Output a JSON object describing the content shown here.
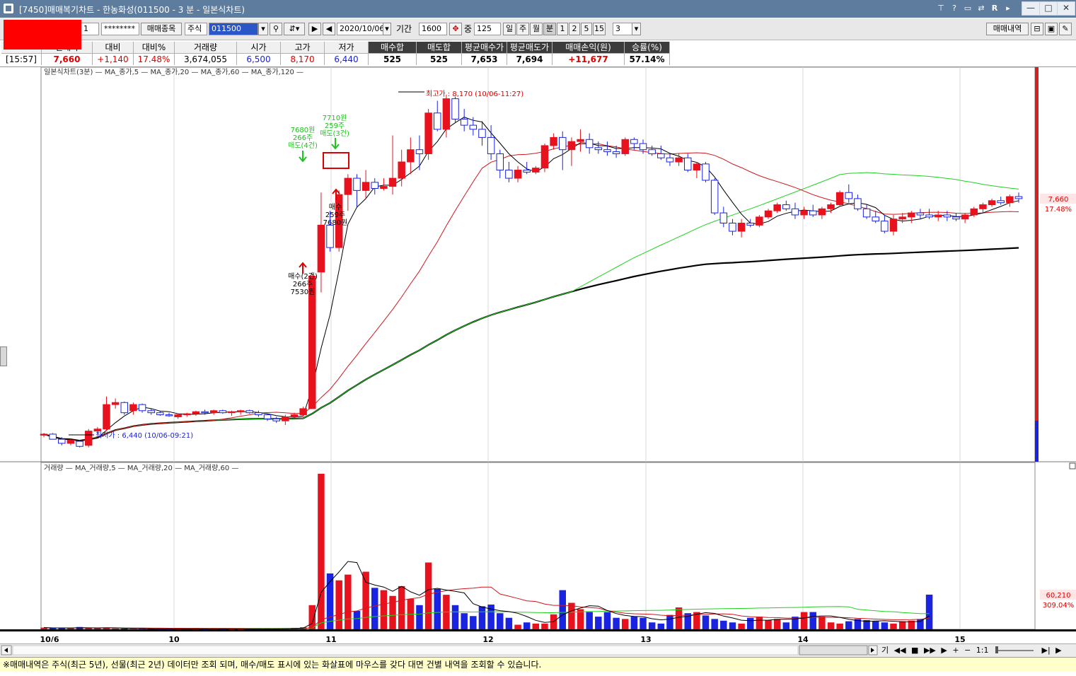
{
  "window": {
    "title": "[7450]매매복기차트 - 한농화성(011500 - 3 분 - 일본식차트)",
    "title_icons": [
      "pin-icon",
      "help-icon",
      "window-icon",
      "link-icon",
      "R",
      "menu-icon"
    ],
    "buttons": {
      "minimize": "—",
      "maximize": "□",
      "close": "✕"
    }
  },
  "toolbar": {
    "account_suffix": "1",
    "password": "********",
    "trade_stock_btn": "매매종목",
    "market_type": "주식",
    "code": "011500",
    "date": "2020/10/06",
    "period_label": "기간",
    "period_value": "1600",
    "middle_label": "중",
    "middle_value": "125",
    "periods": [
      "일",
      "주",
      "월",
      "분",
      "1",
      "2",
      "5",
      "15"
    ],
    "minute_select": "3",
    "history_btn": "매매내역"
  },
  "info": {
    "headers": [
      "",
      "현재가",
      "대비",
      "대비%",
      "거래량",
      "시가",
      "고가",
      "저가",
      "매수합",
      "매도합",
      "평균매수가",
      "평균매도가",
      "매매손익(원)",
      "승률(%)"
    ],
    "values": [
      "[15:57]",
      "7,660",
      "+1,140",
      "17.48%",
      "3,674,055",
      "6,500",
      "8,170",
      "6,440",
      "525",
      "525",
      "7,653",
      "7,694",
      "+11,677",
      "57.14%"
    ]
  },
  "chart_data": [
    {
      "type": "candlestick",
      "legend": "일본식차트(3분) — MA_종가,5 — MA_종가,20 — MA_종가,60 — MA_종가,120 —",
      "legend_items": [
        {
          "name": "일본식차트(3분)",
          "color": "#d0181c"
        },
        {
          "name": "MA_종가,5",
          "color": "#000000"
        },
        {
          "name": "MA_종가,20",
          "color": "#d0181c"
        },
        {
          "name": "MA_종가,60",
          "color": "#1ed21e"
        },
        {
          "name": "MA_종가,120",
          "color": "#000000"
        }
      ],
      "x_tick_labels": [
        "10/6",
        "10",
        "11",
        "12",
        "13",
        "14",
        "15"
      ],
      "y_range": [
        6380,
        8270
      ],
      "current_price_label": "7,660",
      "current_pct_label": "17.48%",
      "annotations": {
        "high": "최고가 : 8,170 (10/06-11:27)",
        "low": "최저가 : 6,440 (10/06-09:21)",
        "sell1": [
          "7680원",
          "266주",
          "매도(4건)"
        ],
        "sell2": [
          "7710원",
          "259주",
          "매도(3건)"
        ],
        "buy1": [
          "매수(2건)",
          "266주",
          "7530원"
        ],
        "buy2": [
          "매수",
          "259주",
          "7680원"
        ]
      },
      "ohlc": [
        [
          6500,
          6510,
          6490,
          6505
        ],
        [
          6505,
          6510,
          6480,
          6480
        ],
        [
          6480,
          6490,
          6450,
          6460
        ],
        [
          6460,
          6480,
          6450,
          6475
        ],
        [
          6470,
          6475,
          6440,
          6445
        ],
        [
          6450,
          6530,
          6440,
          6520
        ],
        [
          6520,
          6540,
          6500,
          6530
        ],
        [
          6530,
          6690,
          6520,
          6650
        ],
        [
          6650,
          6680,
          6630,
          6660
        ],
        [
          6660,
          6665,
          6600,
          6610
        ],
        [
          6620,
          6660,
          6600,
          6650
        ],
        [
          6650,
          6655,
          6610,
          6620
        ],
        [
          6620,
          6630,
          6600,
          6610
        ],
        [
          6610,
          6620,
          6595,
          6600
        ],
        [
          6600,
          6610,
          6590,
          6595
        ],
        [
          6590,
          6605,
          6580,
          6600
        ],
        [
          6600,
          6610,
          6590,
          6605
        ],
        [
          6605,
          6620,
          6595,
          6615
        ],
        [
          6615,
          6625,
          6600,
          6610
        ],
        [
          6610,
          6625,
          6600,
          6620
        ],
        [
          6620,
          6625,
          6605,
          6610
        ],
        [
          6610,
          6620,
          6595,
          6615
        ],
        [
          6615,
          6625,
          6600,
          6620
        ],
        [
          6620,
          6625,
          6605,
          6610
        ],
        [
          6610,
          6620,
          6590,
          6600
        ],
        [
          6600,
          6605,
          6570,
          6580
        ],
        [
          6580,
          6590,
          6560,
          6570
        ],
        [
          6570,
          6600,
          6550,
          6590
        ],
        [
          6590,
          6610,
          6580,
          6600
        ],
        [
          6600,
          6640,
          6590,
          6630
        ],
        [
          6630,
          7300,
          6630,
          7280
        ],
        [
          7300,
          7690,
          7200,
          7530
        ],
        [
          7530,
          7600,
          7400,
          7420
        ],
        [
          7420,
          7700,
          7400,
          7680
        ],
        [
          7680,
          7780,
          7600,
          7760
        ],
        [
          7760,
          7780,
          7620,
          7700
        ],
        [
          7700,
          7800,
          7660,
          7740
        ],
        [
          7740,
          7760,
          7680,
          7710
        ],
        [
          7710,
          7760,
          7700,
          7720
        ],
        [
          7720,
          7970,
          7680,
          7760
        ],
        [
          7760,
          7900,
          7720,
          7840
        ],
        [
          7840,
          7960,
          7780,
          7900
        ],
        [
          7900,
          7970,
          7800,
          7880
        ],
        [
          7880,
          8100,
          7850,
          8080
        ],
        [
          8080,
          8140,
          7990,
          8000
        ],
        [
          8000,
          8170,
          7960,
          8150
        ],
        [
          8150,
          8160,
          8030,
          8050
        ],
        [
          8050,
          8100,
          7990,
          8020
        ],
        [
          8020,
          8060,
          7970,
          8000
        ],
        [
          8000,
          8040,
          7920,
          7960
        ],
        [
          7960,
          8020,
          7850,
          7880
        ],
        [
          7880,
          7900,
          7760,
          7800
        ],
        [
          7800,
          7840,
          7740,
          7760
        ],
        [
          7760,
          7820,
          7740,
          7800
        ],
        [
          7800,
          7840,
          7780,
          7790
        ],
        [
          7790,
          7820,
          7780,
          7810
        ],
        [
          7810,
          7930,
          7790,
          7920
        ],
        [
          7920,
          7980,
          7900,
          7960
        ],
        [
          7960,
          7990,
          7800,
          7900
        ],
        [
          7900,
          7960,
          7820,
          7940
        ],
        [
          7940,
          8000,
          7890,
          7950
        ],
        [
          7950,
          7980,
          7880,
          7910
        ],
        [
          7910,
          7940,
          7880,
          7900
        ],
        [
          7900,
          7940,
          7870,
          7890
        ],
        [
          7890,
          7920,
          7860,
          7880
        ],
        [
          7880,
          7960,
          7870,
          7950
        ],
        [
          7950,
          7960,
          7900,
          7930
        ],
        [
          7930,
          7950,
          7880,
          7900
        ],
        [
          7900,
          7920,
          7870,
          7880
        ],
        [
          7880,
          7920,
          7850,
          7860
        ],
        [
          7860,
          7880,
          7820,
          7840
        ],
        [
          7840,
          7880,
          7820,
          7860
        ],
        [
          7860,
          7880,
          7790,
          7800
        ],
        [
          7800,
          7840,
          7760,
          7830
        ],
        [
          7830,
          7840,
          7740,
          7750
        ],
        [
          7750,
          7760,
          7580,
          7590
        ],
        [
          7590,
          7620,
          7520,
          7540
        ],
        [
          7540,
          7560,
          7480,
          7500
        ],
        [
          7500,
          7560,
          7470,
          7540
        ],
        [
          7540,
          7560,
          7520,
          7530
        ],
        [
          7530,
          7580,
          7520,
          7570
        ],
        [
          7570,
          7610,
          7560,
          7600
        ],
        [
          7600,
          7640,
          7590,
          7630
        ],
        [
          7630,
          7650,
          7600,
          7610
        ],
        [
          7610,
          7640,
          7560,
          7580
        ],
        [
          7580,
          7620,
          7560,
          7600
        ],
        [
          7600,
          7630,
          7570,
          7580
        ],
        [
          7580,
          7620,
          7560,
          7610
        ],
        [
          7610,
          7640,
          7590,
          7630
        ],
        [
          7630,
          7700,
          7620,
          7690
        ],
        [
          7690,
          7730,
          7640,
          7660
        ],
        [
          7660,
          7680,
          7600,
          7610
        ],
        [
          7610,
          7630,
          7560,
          7570
        ],
        [
          7570,
          7600,
          7540,
          7550
        ],
        [
          7550,
          7580,
          7490,
          7500
        ],
        [
          7500,
          7580,
          7480,
          7560
        ],
        [
          7560,
          7590,
          7540,
          7570
        ],
        [
          7570,
          7600,
          7540,
          7590
        ],
        [
          7590,
          7610,
          7560,
          7580
        ],
        [
          7580,
          7610,
          7560,
          7570
        ],
        [
          7570,
          7600,
          7550,
          7580
        ],
        [
          7580,
          7600,
          7550,
          7570
        ],
        [
          7570,
          7590,
          7550,
          7560
        ],
        [
          7560,
          7590,
          7540,
          7580
        ],
        [
          7580,
          7620,
          7570,
          7610
        ],
        [
          7610,
          7640,
          7590,
          7630
        ],
        [
          7630,
          7660,
          7620,
          7650
        ],
        [
          7650,
          7670,
          7630,
          7640
        ],
        [
          7640,
          7680,
          7620,
          7670
        ],
        [
          7670,
          7690,
          7640,
          7660
        ]
      ]
    },
    {
      "type": "bar",
      "legend": "거래량 — MA_거래량,5 — MA_거래량,20 — MA_거래량,60 —",
      "legend_items": [
        {
          "name": "거래량",
          "color": "#d0181c"
        },
        {
          "name": "MA_거래량,5",
          "color": "#000000"
        },
        {
          "name": "MA_거래량,20",
          "color": "#d0181c"
        },
        {
          "name": "MA_거래량,60",
          "color": "#1ed21e"
        }
      ],
      "current_volume_label": "60,210",
      "current_pct_label": "309.04%",
      "y_range": [
        0,
        270000
      ],
      "values": [
        3000,
        2000,
        2500,
        1800,
        4000,
        2200,
        1900,
        3000,
        1500,
        1200,
        1000,
        900,
        1100,
        800,
        700,
        900,
        1000,
        800,
        700,
        900,
        800,
        700,
        600,
        900,
        1000,
        1200,
        1500,
        1800,
        2500,
        3500,
        42000,
        270000,
        97000,
        85000,
        95000,
        32000,
        100000,
        72000,
        68000,
        58000,
        75000,
        53000,
        42000,
        116000,
        70000,
        60000,
        42000,
        28000,
        23000,
        40000,
        43000,
        28000,
        20000,
        8000,
        12000,
        10000,
        10000,
        26000,
        68000,
        46000,
        35000,
        30000,
        22000,
        30000,
        20000,
        18000,
        22000,
        20000,
        12000,
        10000,
        25000,
        38000,
        28000,
        30000,
        24000,
        18000,
        15000,
        12000,
        10000,
        20000,
        22000,
        16000,
        18000,
        12000,
        22000,
        30000,
        30000,
        22000,
        12000,
        10000,
        14000,
        18000,
        16000,
        14000,
        12000,
        10000,
        14000,
        15000,
        18000,
        60210
      ]
    }
  ],
  "statusbar": {
    "text": "※매매내역은 주식(최근 5년), 선물(최근 2년) 데이터만 조회 되며, 매수/매도 표시에 있는 화살표에 마우스를 갖다 대면 건별 내역을 조회할 수 있습니다."
  },
  "scrollbar": {
    "zoom_ratio": "1:1",
    "nav_label": "기"
  },
  "colors": {
    "up": "#e8121e",
    "down": "#1a23e0",
    "ma_black": "#000000",
    "ma_red": "#d0181c",
    "ma_green": "#1ed21e",
    "title_bar": "#5e7c9e"
  }
}
